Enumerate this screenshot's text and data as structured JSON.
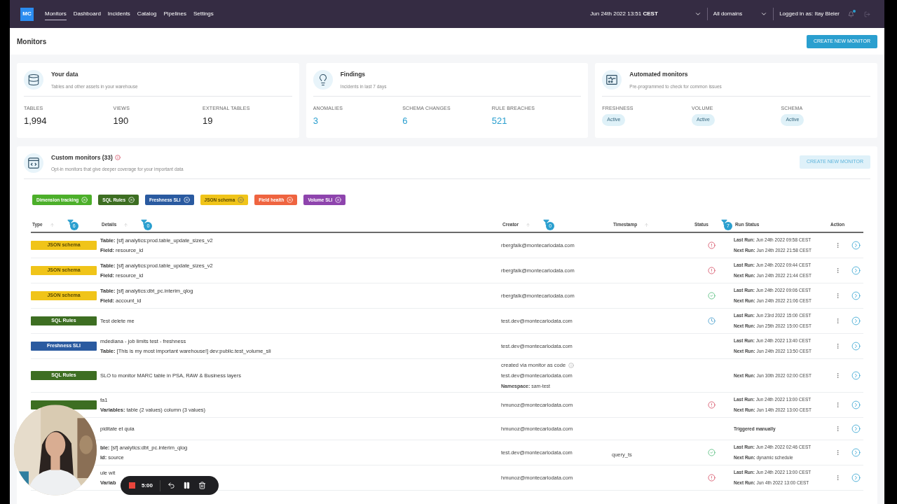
{
  "nav": {
    "logo": "MC",
    "tabs": [
      {
        "label": "Monitors",
        "selected": true
      },
      {
        "label": "Dashboard",
        "selected": false
      },
      {
        "label": "Incidents",
        "selected": false
      },
      {
        "label": "Catalog",
        "selected": false
      },
      {
        "label": "Pipelines",
        "selected": false
      },
      {
        "label": "Settings",
        "selected": false
      }
    ],
    "date": "Jun 24th 2022 13:51 **CEST**",
    "domain": "All domains",
    "user": "Logged in as: Itay Bleier",
    "notification": true
  },
  "header": {
    "title": "Monitors",
    "button": "CREATE NEW MONITOR"
  },
  "cards": [
    {
      "kind": "database",
      "title": "Your data",
      "subtitle": "Tables and other assets in your warehouse",
      "stats": [
        {
          "label": "TABLES",
          "value": "1,994",
          "kind": "plain"
        },
        {
          "label": "VIEWS",
          "value": "190",
          "kind": "plain"
        },
        {
          "label": "EXTERNAL TABLES",
          "value": "19",
          "kind": "plain"
        }
      ]
    },
    {
      "kind": "bulb",
      "title": "Findings",
      "subtitle": "Incidents in last 7 days",
      "stats": [
        {
          "label": "ANOMALIES",
          "value": "3",
          "kind": "accent"
        },
        {
          "label": "SCHEMA CHANGES",
          "value": "6",
          "kind": "accent"
        },
        {
          "label": "RULE BREACHES",
          "value": "521",
          "kind": "accent"
        }
      ]
    },
    {
      "kind": "panel",
      "title": "Automated monitors",
      "subtitle": "Pre-programmed to check for common issues",
      "stats": [
        {
          "label": "FRESHNESS",
          "value": "Active",
          "kind": "pill"
        },
        {
          "label": "VOLUME",
          "value": "Active",
          "kind": "pill"
        },
        {
          "label": "SCHEMA",
          "value": "Active",
          "kind": "pill"
        }
      ]
    }
  ],
  "custom": {
    "title": "Custom monitors (33)",
    "subtitle": "Opt-in monitors that give deeper coverage for your important data",
    "button": "CREATE NEW MONITOR",
    "filters": [
      {
        "label": "Dimension tracking",
        "color": "#4caf2a"
      },
      {
        "label": "SQL Rules",
        "color": "#3d6e22"
      },
      {
        "label": "Freshness SLI",
        "color": "#2a5aa0"
      },
      {
        "label": "JSON schema",
        "color": "#f0c419"
      },
      {
        "label": "Field health",
        "color": "#ef6440"
      },
      {
        "label": "Volume SLI",
        "color": "#8e44ad"
      }
    ],
    "columns": [
      {
        "label": "Type",
        "sort": true,
        "filter_count": "6"
      },
      {
        "label": "Details",
        "sort": true,
        "filter_count": "0"
      },
      {
        "label": "Creator",
        "sort": true,
        "filter_count": "0"
      },
      {
        "label": "Timestamp",
        "sort": true
      },
      {
        "label": "Status",
        "sort": false,
        "filter_count": "7"
      },
      {
        "label": "Run Status",
        "sort": false
      },
      {
        "label": "Action",
        "sort": false
      }
    ],
    "rows": [
      {
        "type": {
          "label": "JSON schema",
          "color": "#f0c419"
        },
        "details": [
          "**Table:** [sf] analytics:prod.table_update_sizes_v2",
          "**Field:** resource_id"
        ],
        "creator": "rbergfalk@montecarlodata.com",
        "status": {
          "kind": "error"
        },
        "runs": [
          "**Last Run:** Jun 24th 2022 09:58 CEST",
          "**Next Run:** Jun 24th 2022 21:58 CEST"
        ]
      },
      {
        "type": {
          "label": "JSON schema",
          "color": "#f0c419"
        },
        "details": [
          "**Table:** [sf] analytics:prod.table_update_sizes_v2",
          "**Field:** resource_id"
        ],
        "creator": "rbergfalk@montecarlodata.com",
        "status": {
          "kind": "error"
        },
        "runs": [
          "**Last Run:** Jun 24th 2022 09:44 CEST",
          "**Next Run:** Jun 24th 2022 21:44 CEST"
        ]
      },
      {
        "type": {
          "label": "JSON schema",
          "color": "#f0c419"
        },
        "details": [
          "**Table:** [sf] analytics:dbt_pc.interim_qlog",
          "**Field:** account_id"
        ],
        "creator": "rbergfalk@montecarlodata.com",
        "status": {
          "kind": "ok"
        },
        "runs": [
          "**Last Run:** Jun 24th 2022 09:06 CEST",
          "**Next Run:** Jun 24th 2022 21:06 CEST"
        ]
      },
      {
        "type": {
          "label": "SQL Rules",
          "color": "#3d6e22"
        },
        "details": [
          "Test delete me"
        ],
        "creator": "test.dev@montecarlodata.com",
        "status": {
          "kind": "scheduled"
        },
        "runs": [
          "**Last Run:** Jun 23rd 2022 15:00 CEST",
          "**Next Run:** Jun 25th 2022 15:00 CEST"
        ]
      },
      {
        "type": {
          "label": "Freshness SLI",
          "color": "#2a5aa0"
        },
        "details": [
          "mdediana - job limits test - freshness",
          "**Table:** [This is my most important warehouse!] dev:public.test_volume_sli"
        ],
        "creator": "test.dev@montecarlodata.com",
        "runs": [
          "**Last Run:** Jun 24th 2022 13:40 CEST",
          "**Next Run:** Jun 24th 2022 13:50 CEST"
        ]
      },
      {
        "type": {
          "label": "SQL Rules",
          "color": "#3d6e22"
        },
        "details": [
          "SLO to monitor MARC table in PSA, RAW & Business layers"
        ],
        "creator_note": "created via monitor as code",
        "creator": "test.dev@montecarlodata.com",
        "namespace": "**Namespace:** sam-test",
        "runs": [
          "**Next Run:** Jun 30th 2022 02:00 CEST"
        ]
      },
      {
        "type": {
          "color": "#3d6e22"
        },
        "details": [
          "fa1",
          "**Variables:** table (2 values) column (3 values)"
        ],
        "creator": "hmunoz@montecarlodata.com",
        "status": {
          "kind": "error"
        },
        "runs": [
          "**Last Run:** Jun 24th 2022 13:00 CEST",
          "**Next Run:** Jun 14th 2022 13:00 CEST"
        ]
      },
      {
        "details": [
          "piditate et quia"
        ],
        "creator": "hmunoz@montecarlodata.com",
        "run_note": "Triggered manually"
      },
      {
        "details": [
          "**ble:** [sf] analytics:dbt_pc.interim_qlog",
          "**ld:** source"
        ],
        "creator": "test.dev@montecarlodata.com",
        "timestamp": "query_ts",
        "status": {
          "kind": "ok"
        },
        "runs": [
          "**Last Run:** Jun 24th 2022 02:46 CEST",
          "**Next Run:** dynamic schedule"
        ]
      },
      {
        "details": [
          "ule wit",
          "**Variab**"
        ],
        "creator": "hmunoz@montecarlodata.com",
        "status": {
          "kind": "error"
        },
        "runs": [
          "**Last Run:** Jun 24th 2022 13:00 CEST",
          "**Next Run:** Jun 4th 2022 13:00 CEST"
        ]
      }
    ]
  },
  "recorder": {
    "time": "5:00"
  }
}
